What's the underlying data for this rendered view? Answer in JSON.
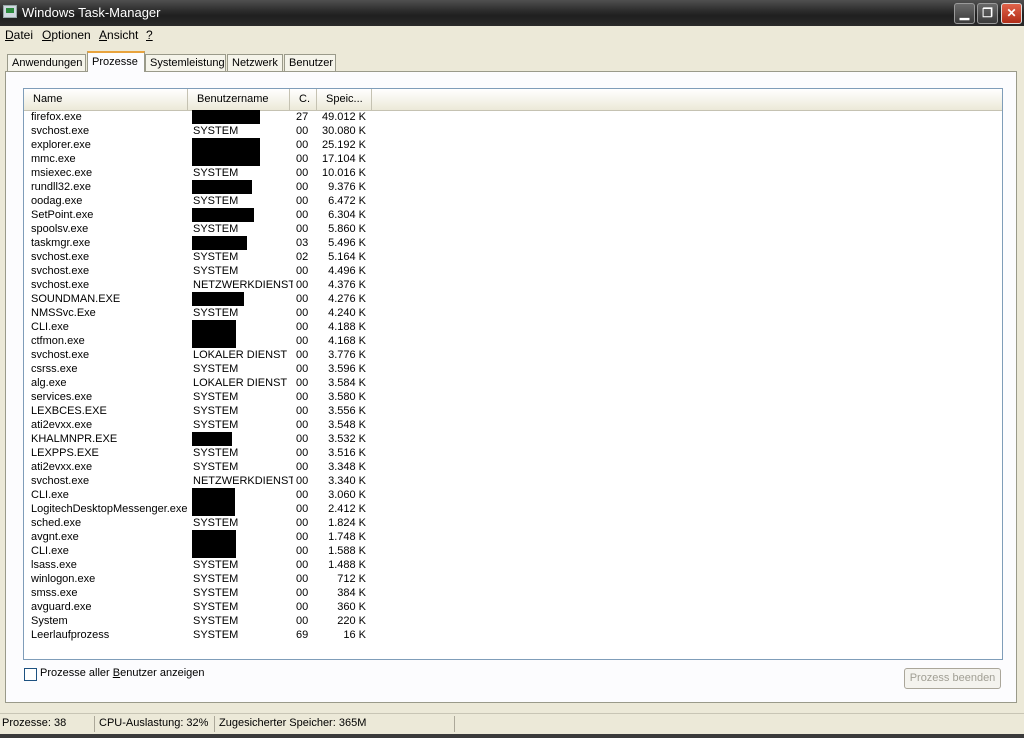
{
  "window": {
    "title": "Windows Task-Manager",
    "min_glyph": "▁",
    "max_glyph": "❐",
    "close_glyph": "✕"
  },
  "menu": {
    "items": [
      {
        "label": "Datei",
        "accel": "D",
        "rest": "atei"
      },
      {
        "label": "Optionen",
        "accel": "O",
        "rest": "ptionen"
      },
      {
        "label": "Ansicht",
        "accel": "A",
        "rest": "nsicht"
      },
      {
        "label": "?",
        "accel": "?",
        "rest": ""
      }
    ]
  },
  "tabs": [
    {
      "label": "Anwendungen",
      "active": false
    },
    {
      "label": "Prozesse",
      "active": true
    },
    {
      "label": "Systemleistung",
      "active": false
    },
    {
      "label": "Netzwerk",
      "active": false
    },
    {
      "label": "Benutzer",
      "active": false
    }
  ],
  "table": {
    "columns": [
      "Name",
      "Benutzername",
      "C.",
      "Speic..."
    ],
    "rows": [
      {
        "name": "firefox.exe",
        "user": "",
        "redacted": true,
        "cpu": "27",
        "mem": "49.012 K"
      },
      {
        "name": "svchost.exe",
        "user": "SYSTEM",
        "redacted": false,
        "cpu": "00",
        "mem": "30.080 K"
      },
      {
        "name": "explorer.exe",
        "user": "",
        "redacted": true,
        "cpu": "00",
        "mem": "25.192 K"
      },
      {
        "name": "mmc.exe",
        "user": "",
        "redacted": true,
        "cpu": "00",
        "mem": "17.104 K"
      },
      {
        "name": "msiexec.exe",
        "user": "SYSTEM",
        "redacted": false,
        "cpu": "00",
        "mem": "10.016 K"
      },
      {
        "name": "rundll32.exe",
        "user": "",
        "redacted": true,
        "cpu": "00",
        "mem": "9.376 K"
      },
      {
        "name": "oodag.exe",
        "user": "SYSTEM",
        "redacted": false,
        "cpu": "00",
        "mem": "6.472 K"
      },
      {
        "name": "SetPoint.exe",
        "user": "",
        "redacted": true,
        "cpu": "00",
        "mem": "6.304 K"
      },
      {
        "name": "spoolsv.exe",
        "user": "SYSTEM",
        "redacted": false,
        "cpu": "00",
        "mem": "5.860 K"
      },
      {
        "name": "taskmgr.exe",
        "user": "",
        "redacted": true,
        "cpu": "03",
        "mem": "5.496 K"
      },
      {
        "name": "svchost.exe",
        "user": "SYSTEM",
        "redacted": false,
        "cpu": "02",
        "mem": "5.164 K"
      },
      {
        "name": "svchost.exe",
        "user": "SYSTEM",
        "redacted": false,
        "cpu": "00",
        "mem": "4.496 K"
      },
      {
        "name": "svchost.exe",
        "user": "NETZWERKDIENST",
        "redacted": false,
        "cpu": "00",
        "mem": "4.376 K"
      },
      {
        "name": "SOUNDMAN.EXE",
        "user": "",
        "redacted": true,
        "cpu": "00",
        "mem": "4.276 K"
      },
      {
        "name": "NMSSvc.Exe",
        "user": "SYSTEM",
        "redacted": false,
        "cpu": "00",
        "mem": "4.240 K"
      },
      {
        "name": "CLI.exe",
        "user": "",
        "redacted": true,
        "cpu": "00",
        "mem": "4.188 K"
      },
      {
        "name": "ctfmon.exe",
        "user": "",
        "redacted": true,
        "cpu": "00",
        "mem": "4.168 K"
      },
      {
        "name": "svchost.exe",
        "user": "LOKALER DIENST",
        "redacted": false,
        "cpu": "00",
        "mem": "3.776 K"
      },
      {
        "name": "csrss.exe",
        "user": "SYSTEM",
        "redacted": false,
        "cpu": "00",
        "mem": "3.596 K"
      },
      {
        "name": "alg.exe",
        "user": "LOKALER DIENST",
        "redacted": false,
        "cpu": "00",
        "mem": "3.584 K"
      },
      {
        "name": "services.exe",
        "user": "SYSTEM",
        "redacted": false,
        "cpu": "00",
        "mem": "3.580 K"
      },
      {
        "name": "LEXBCES.EXE",
        "user": "SYSTEM",
        "redacted": false,
        "cpu": "00",
        "mem": "3.556 K"
      },
      {
        "name": "ati2evxx.exe",
        "user": "SYSTEM",
        "redacted": false,
        "cpu": "00",
        "mem": "3.548 K"
      },
      {
        "name": "KHALMNPR.EXE",
        "user": "",
        "redacted": true,
        "cpu": "00",
        "mem": "3.532 K"
      },
      {
        "name": "LEXPPS.EXE",
        "user": "SYSTEM",
        "redacted": false,
        "cpu": "00",
        "mem": "3.516 K"
      },
      {
        "name": "ati2evxx.exe",
        "user": "SYSTEM",
        "redacted": false,
        "cpu": "00",
        "mem": "3.348 K"
      },
      {
        "name": "svchost.exe",
        "user": "NETZWERKDIENST",
        "redacted": false,
        "cpu": "00",
        "mem": "3.340 K"
      },
      {
        "name": "CLI.exe",
        "user": "",
        "redacted": true,
        "cpu": "00",
        "mem": "3.060 K"
      },
      {
        "name": "LogitechDesktopMessenger.exe",
        "user": "",
        "redacted": true,
        "cpu": "00",
        "mem": "2.412 K"
      },
      {
        "name": "sched.exe",
        "user": "SYSTEM",
        "redacted": false,
        "cpu": "00",
        "mem": "1.824 K"
      },
      {
        "name": "avgnt.exe",
        "user": "",
        "redacted": true,
        "cpu": "00",
        "mem": "1.748 K"
      },
      {
        "name": "CLI.exe",
        "user": "",
        "redacted": true,
        "cpu": "00",
        "mem": "1.588 K"
      },
      {
        "name": "lsass.exe",
        "user": "SYSTEM",
        "redacted": false,
        "cpu": "00",
        "mem": "1.488 K"
      },
      {
        "name": "winlogon.exe",
        "user": "SYSTEM",
        "redacted": false,
        "cpu": "00",
        "mem": "712 K"
      },
      {
        "name": "smss.exe",
        "user": "SYSTEM",
        "redacted": false,
        "cpu": "00",
        "mem": "384 K"
      },
      {
        "name": "avguard.exe",
        "user": "SYSTEM",
        "redacted": false,
        "cpu": "00",
        "mem": "360 K"
      },
      {
        "name": "System",
        "user": "SYSTEM",
        "redacted": false,
        "cpu": "00",
        "mem": "220 K"
      },
      {
        "name": "Leerlaufprozess",
        "user": "SYSTEM",
        "redacted": false,
        "cpu": "69",
        "mem": "16 K"
      }
    ]
  },
  "footer": {
    "show_all_label_pre": "Prozesse aller ",
    "show_all_label_accel": "B",
    "show_all_label_post": "enutzer anzeigen",
    "show_all_checked": false,
    "end_process_label": "Prozess beenden"
  },
  "status": {
    "processes": "Prozesse: 38",
    "cpu": "CPU-Auslastung: 32%",
    "commit": "Zugesicherter Speicher: 365M"
  }
}
